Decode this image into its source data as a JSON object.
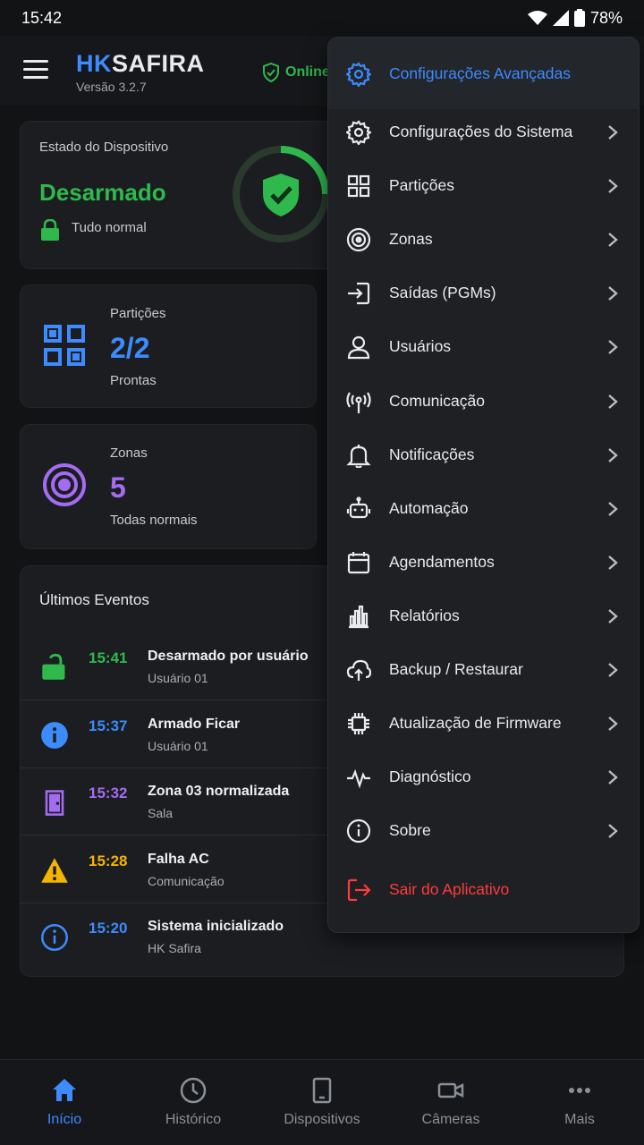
{
  "status_bar": {
    "time": "15:42",
    "battery": "78%"
  },
  "header": {
    "brand_hk": "HK",
    "brand_name": "SAFIRA",
    "version": "Versão 3.2.7",
    "online": "Online"
  },
  "device": {
    "label": "Estado do Dispositivo",
    "status": "Desarmado",
    "status_note": "Tudo normal"
  },
  "partitions": {
    "label": "Partições",
    "value": "2/2",
    "sub": "Prontas"
  },
  "zones": {
    "label": "Zonas",
    "value": "5",
    "sub": "Todas normais"
  },
  "events": {
    "title": "Últimos Eventos",
    "items": [
      {
        "time": "15:41",
        "title": "Desarmado por usuário",
        "sub": "Usuário 01",
        "color": "#2fb94d",
        "icon": "unlock-icon"
      },
      {
        "time": "15:37",
        "title": "Armado Ficar",
        "sub": "Usuário 01",
        "color": "#3d8bfd",
        "icon": "info-filled-icon"
      },
      {
        "time": "15:32",
        "title": "Zona 03 normalizada",
        "sub": "Sala",
        "color": "#a46cf0",
        "icon": "door-icon"
      },
      {
        "time": "15:28",
        "title": "Falha AC",
        "sub": "Comunicação",
        "color": "#f5b400",
        "icon": "warning-icon"
      },
      {
        "time": "15:20",
        "title": "Sistema inicializado",
        "sub": "HK Safira",
        "color": "#3d8bfd",
        "icon": "info-icon"
      }
    ]
  },
  "menu": {
    "header": "Configurações Avançadas",
    "items": [
      {
        "label": "Configurações do Sistema",
        "icon": "gear-icon"
      },
      {
        "label": "Partições",
        "icon": "partitions-icon"
      },
      {
        "label": "Zonas",
        "icon": "target-icon"
      },
      {
        "label": "Saídas (PGMs)",
        "icon": "output-icon"
      },
      {
        "label": "Usuários",
        "icon": "user-icon"
      },
      {
        "label": "Comunicação",
        "icon": "antenna-icon"
      },
      {
        "label": "Notificações",
        "icon": "bell-icon"
      },
      {
        "label": "Automação",
        "icon": "robot-icon"
      },
      {
        "label": "Agendamentos",
        "icon": "calendar-icon"
      },
      {
        "label": "Relatórios",
        "icon": "bar-chart-icon"
      },
      {
        "label": "Backup / Restaurar",
        "icon": "cloud-upload-icon"
      },
      {
        "label": "Atualização de Firmware",
        "icon": "chip-icon"
      },
      {
        "label": "Diagnóstico",
        "icon": "pulse-icon"
      },
      {
        "label": "Sobre",
        "icon": "info-icon"
      }
    ],
    "exit": "Sair do Aplicativo"
  },
  "nav": {
    "items": [
      {
        "label": "Início",
        "icon": "home-icon"
      },
      {
        "label": "Histórico",
        "icon": "clock-icon"
      },
      {
        "label": "Dispositivos",
        "icon": "tablet-icon"
      },
      {
        "label": "Câmeras",
        "icon": "camera-icon"
      },
      {
        "label": "Mais",
        "icon": "more-icon"
      }
    ]
  },
  "colors": {
    "accent": "#3d8bfd",
    "success": "#2fb94d",
    "purple": "#a46cf0",
    "warning": "#f5b400",
    "danger": "#ff3b3b"
  }
}
